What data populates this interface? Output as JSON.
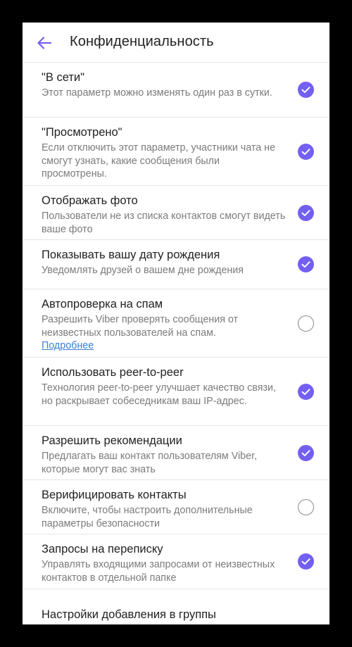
{
  "header": {
    "title": "Конфиденциальность"
  },
  "colors": {
    "accent": "#7360f2",
    "back_icon": "#7360f2"
  },
  "settings": [
    {
      "title": "\"В сети\"",
      "desc": "Этот параметр можно изменять один раз в сутки.",
      "checked": true
    },
    {
      "title": "\"Просмотрено\"",
      "desc": "Если отключить этот параметр, участники чата не смогут узнать, какие сообщения были просмотрены.",
      "checked": true
    },
    {
      "title": "Отображать фото",
      "desc": "Пользователи не из списка контактов смогут видеть ваше фото",
      "checked": true
    },
    {
      "title": "Показывать вашу дату рождения",
      "desc": "Уведомлять друзей о вашем дне рождения",
      "checked": true
    },
    {
      "title": "Автопроверка на спам",
      "desc": "Разрешить Viber проверять сообщения от неизвестных пользователей на спам.",
      "link": "Подробнее",
      "checked": false
    },
    {
      "title": "Использовать peer-to-peer",
      "desc": "Технология peer-to-peer улучшает качество связи, но раскрывает собеседникам ваш IP-адрес.",
      "checked": true
    },
    {
      "title": "Разрешить рекомендации",
      "desc": "Предлагать ваш контакт пользователям Viber, которые могут вас знать",
      "checked": true
    },
    {
      "title": "Верифицировать контакты",
      "desc": "Включите, чтобы настроить дополнительные параметры безопасности",
      "checked": false
    },
    {
      "title": "Запросы на переписку",
      "desc": "Управлять входящими запросами от неизвестных контактов в отдельной папке",
      "checked": true
    },
    {
      "title": "Настройки добавления в группы"
    }
  ]
}
